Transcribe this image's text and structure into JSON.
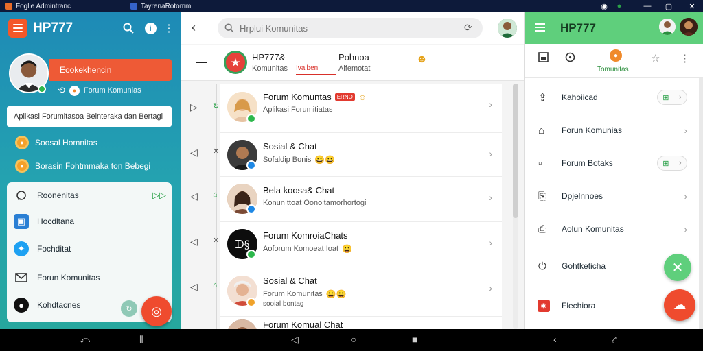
{
  "titlebar": {
    "tabs": [
      {
        "title": "Foglie Admintranc",
        "color": "#e96c2a"
      },
      {
        "title": "TayrenaRotomm",
        "color": "#3563c9"
      }
    ],
    "controls": [
      "◉",
      "●",
      "—",
      "▢",
      "✕"
    ]
  },
  "left": {
    "title": "HP777",
    "profile_button": "Eookekhencin",
    "forum_chip": "Forum Komunias",
    "description": "Aplikasi Forumitasoa Beinteraka dan Bertagi",
    "rows": [
      {
        "label": "Soosal Homnitas",
        "icon": "orange-circle-icon"
      },
      {
        "label": "Borasin Fohtmmaka ton Bebegi",
        "icon": "orange-circle-icon"
      }
    ],
    "card": {
      "items": [
        {
          "label": "Roonenitas",
          "icon": "chat-icon",
          "icon_color": "#333"
        },
        {
          "label": "Hocdltana",
          "icon": "page-icon",
          "icon_color": "#2a7fd4"
        },
        {
          "label": "Fochditat",
          "icon": "twitter-icon",
          "icon_color": "#1da1f2"
        },
        {
          "label": "Forun Komunitas",
          "icon": "mail-icon",
          "icon_color": "#333"
        },
        {
          "label": "Kohdtacnes",
          "icon": "avatar-icon",
          "icon_color": "#111"
        }
      ]
    }
  },
  "middle": {
    "search_placeholder": "Hrplui Komunitas",
    "header": {
      "title": "HP777&",
      "subtitle": "Komunitas",
      "active_tab": "Ivaiben",
      "title2": "Pohnoa",
      "subtitle2": "Aifemotat"
    },
    "rows": [
      {
        "title": "Forum Komuntas",
        "tag": "ERNO",
        "subtitle": "Aplikasi Forumitiatas",
        "subtitle2": "",
        "avatar_bg": "#f3d9b8"
      },
      {
        "title": "Sosial & Chat",
        "tag": "",
        "subtitle": "Sofaldip Bonis",
        "emoji": "😀😀",
        "subtitle2": "",
        "avatar_bg": "#2b2b2b"
      },
      {
        "title": "Bela koosa& Chat",
        "tag": "",
        "subtitle": "Konun ttoat Oonoitamorhortogi",
        "subtitle2": "",
        "avatar_bg": "#c98d5a"
      },
      {
        "title": "Forum KomroiaChats",
        "tag": "",
        "subtitle": "Aoforum Komoeat Ioat",
        "emoji": "😀",
        "subtitle2": "",
        "avatar_bg": "#111111"
      },
      {
        "title": "Sosial & Chat",
        "tag": "",
        "subtitle": "Forum Komunitas",
        "emoji": "😀😀",
        "subtitle2": "sooial bontag",
        "avatar_bg": "#e7c4b0"
      },
      {
        "title": "Forum Komual Chat",
        "tag": "",
        "subtitle": "",
        "subtitle2": "",
        "avatar_bg": "#7a4a35"
      }
    ]
  },
  "right": {
    "title": "HP777",
    "tab_label": "Tomunitas",
    "items": [
      {
        "label": "Kahoiicad",
        "icon": "share-icon",
        "pill": true
      },
      {
        "label": "Forun Komunias",
        "icon": "home-icon",
        "pill": false
      },
      {
        "label": "Forum Botaks",
        "icon": "doc-icon",
        "pill": true
      },
      {
        "label": "Dpjelnnoes",
        "icon": "bookmark-icon",
        "pill": false
      },
      {
        "label": "Aolun Komunitas",
        "icon": "file-icon",
        "pill": false
      },
      {
        "label": "Gohtketicha",
        "icon": "power-icon",
        "pill": false
      },
      {
        "label": "Flechiora",
        "icon": "red-badge-icon",
        "pill": false
      }
    ]
  },
  "colors": {
    "accent_orange": "#ee5a36",
    "accent_green": "#5fcf7c",
    "left_bg": "#1e8ab6"
  }
}
